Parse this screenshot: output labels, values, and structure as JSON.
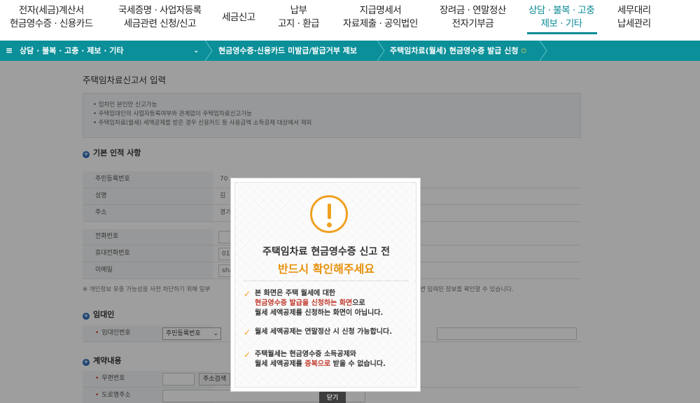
{
  "topnav": {
    "items": [
      {
        "l1": "전자(세금)계산서",
        "l2": "현금영수증 · 신용카드"
      },
      {
        "l1": "국세증명 · 사업자등록",
        "l2": "세금관련 신청/신고"
      },
      {
        "l1": "세금신고",
        "l2": ""
      },
      {
        "l1": "납부",
        "l2": "고지 · 환급"
      },
      {
        "l1": "지급명세서",
        "l2": "자료제출 · 공익법인"
      },
      {
        "l1": "장려금 · 연말정산",
        "l2": "전자기부금"
      },
      {
        "l1": "상담 · 불복 · 고충",
        "l2": "제보 · 기타"
      },
      {
        "l1": "세무대리",
        "l2": "납세관리"
      }
    ]
  },
  "breadcrumb": {
    "menu_icon": "≡",
    "level1": "상담 · 불복 · 고충 · 제보 · 기타",
    "chevron": "⌄",
    "level2": "현금영수증·신용카드 미발급/발급거부 제보",
    "level3": "주택임차료(월세) 현금영수증 발급 신청",
    "star": "✩"
  },
  "page": {
    "title": "주택임차료신고서 입력",
    "notices": [
      "• 임차인 본인만 신고가능",
      "• 주택임대인의 사업자등록여부와 관계없이 주택임차료신고가능",
      "• 주택임차료(월세) 세액공제를 받은 경우 신용카드 등 사용금액 소득공제 대상에서 제외"
    ],
    "section1": "기본 인적 사항",
    "rows1": [
      {
        "label": "주민등록번호",
        "value": "70"
      },
      {
        "label": "성명",
        "value": "김"
      },
      {
        "label": "주소",
        "value": "경기"
      }
    ],
    "rows2": [
      {
        "label": "전화번호",
        "value": ""
      },
      {
        "label": "휴대전화번호",
        "value": "010"
      },
      {
        "label": "이메일",
        "value": "sha"
      }
    ],
    "privacy_left": "※ 개인정보 유출 가능성을 사전 차단하기 위해 일부",
    "privacy_right": "면 입력된 정보를 확인할 수 있습니다.",
    "section2": "임대인",
    "landlord_label": "임대인번호",
    "landlord_select": "주민등록번호",
    "section3": "계약내용",
    "postcode_label": "우편번호",
    "address_search": "주소검색",
    "road_label": "도로명주소"
  },
  "modal": {
    "title1": "주택임차료 현금영수증 신고 전",
    "title2": "반드시 확인해주세요",
    "b1_l1": "본 화면은 주택 월세에 대한",
    "b1_red": "현금영수증 발급을 신청하는 화면",
    "b1_suffix": "으로",
    "b1_l3": "월세 세액공제를 신청하는 화면이 아닙니다.",
    "b2": "월세 세액공제는 연말정산 시 신청 가능합니다.",
    "b3_l1": "주택월세는 현금영수증 소득공제와",
    "b3_l2a": "월세 세액공제를 ",
    "b3_red": "중복으로",
    "b3_l2b": " 받을 수 없습니다.",
    "check": "✓",
    "close": "닫기"
  },
  "colors": {
    "teal": "#0b8f99",
    "accent_orange": "#f0a020",
    "warning_red": "#c0392b"
  }
}
